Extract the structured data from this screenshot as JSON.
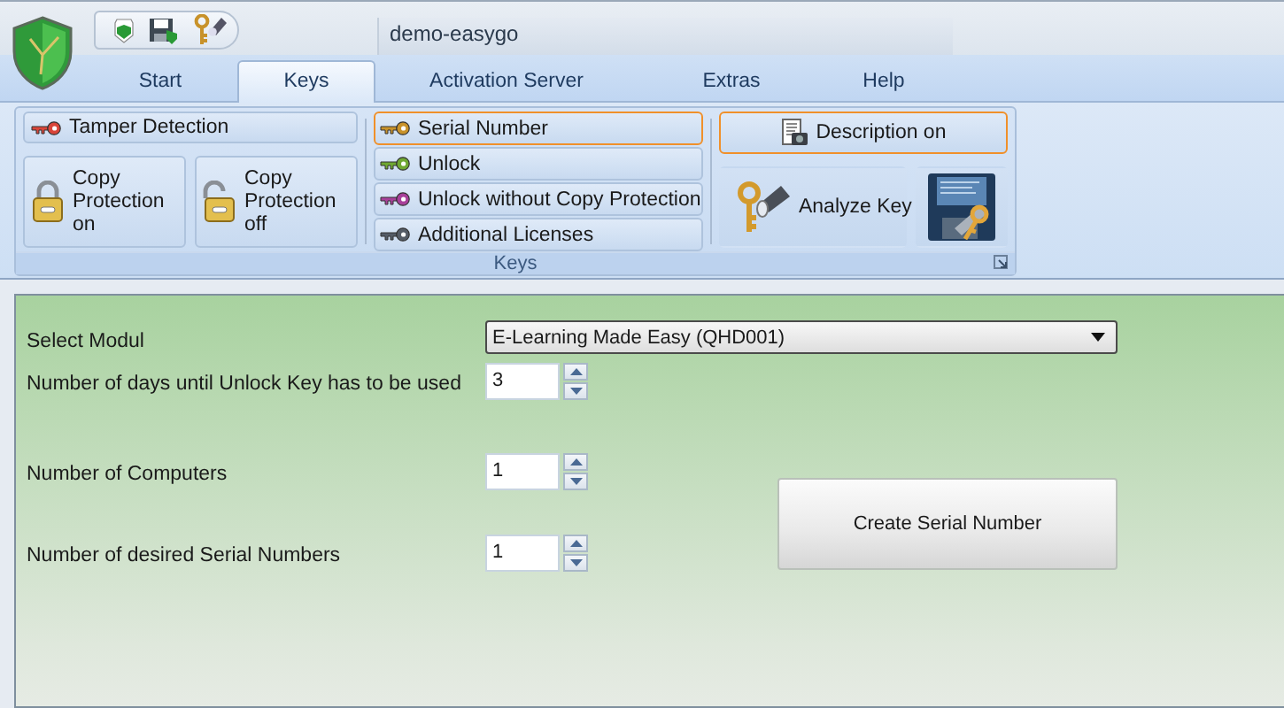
{
  "document_title": "demo-easygo",
  "tabs": [
    {
      "label": "Start",
      "selected": false
    },
    {
      "label": "Keys",
      "selected": true
    },
    {
      "label": "Activation Server",
      "selected": false
    },
    {
      "label": "Extras",
      "selected": false
    },
    {
      "label": "Help",
      "selected": false
    }
  ],
  "ribbon": {
    "group_label": "Keys",
    "tamper_button": {
      "label": "Tamper Detection",
      "color": "#d9453a"
    },
    "protection_buttons": [
      {
        "label": "Copy Protection on",
        "kind": "locked"
      },
      {
        "label": "Copy Protection off",
        "kind": "unlocked"
      }
    ],
    "key_buttons": [
      {
        "label": "Serial Number",
        "color": "#c8922a",
        "highlighted": true
      },
      {
        "label": "Unlock",
        "color": "#6fa832",
        "highlighted": false
      },
      {
        "label": "Unlock without Copy Protection",
        "color": "#a8409a",
        "highlighted": false
      },
      {
        "label": "Additional Licenses",
        "color": "#555c66",
        "highlighted": false
      }
    ],
    "description_button": {
      "label": "Description on",
      "highlighted": true
    },
    "analyze_button": {
      "label": "Analyze Key"
    }
  },
  "form": {
    "fields": [
      {
        "kind": "select",
        "label": "Select Modul",
        "value": "E-Learning Made Easy (QHD001)"
      },
      {
        "kind": "spinner",
        "label": "Number of days until Unlock Key has to be used",
        "value": "3"
      },
      {
        "kind": "spinner",
        "label": "Number of Computers",
        "value": "1"
      },
      {
        "kind": "spinner",
        "label": "Number of desired Serial Numbers",
        "value": "1"
      }
    ],
    "action_button": "Create Serial Number"
  }
}
